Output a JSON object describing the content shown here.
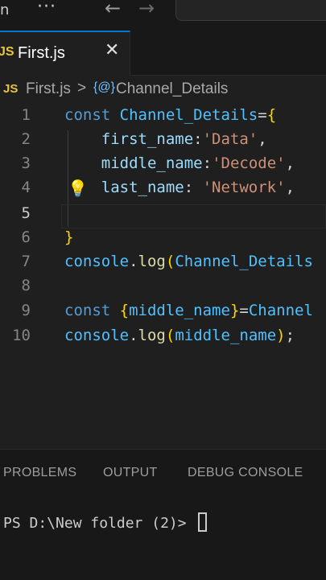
{
  "titlebar": {
    "left_text": "n",
    "more": "···",
    "back": "←",
    "forward": "→"
  },
  "tab": {
    "lang": "JS",
    "name": "First.js",
    "close": "✕"
  },
  "breadcrumb": {
    "lang": "JS",
    "file": "First.js",
    "sep": ">",
    "symbol_icon": "{@}",
    "symbol": "Channel_Details"
  },
  "editor": {
    "line_numbers": [
      "1",
      "2",
      "3",
      "4",
      "5",
      "6",
      "7",
      "8",
      "9",
      "10"
    ],
    "lines": {
      "l1": {
        "kw": "const",
        "name": "Channel_Details",
        "op": "=",
        "brace": "{"
      },
      "l2": {
        "prop": "first_name",
        "colon": ":",
        "str": "'Data'",
        "comma": ","
      },
      "l3": {
        "prop": "middle_name",
        "colon": ":",
        "str": "'Decode'",
        "comma": ","
      },
      "l4": {
        "prop": "last_name",
        "colon": ": ",
        "str": "'Network'",
        "comma": ","
      },
      "l6": {
        "brace": "}"
      },
      "l7": {
        "obj": "console",
        "dot": ".",
        "fn": "log",
        "paren": "(",
        "arg": "Channel_Details"
      },
      "l9": {
        "kw": "const",
        "brace_open": "{",
        "name": "middle_name",
        "brace_close": "}",
        "op": "=",
        "rhs": "Channel"
      },
      "l10": {
        "obj": "console",
        "dot": ".",
        "fn": "log",
        "paren_open": "(",
        "arg": "middle_name",
        "paren_close": ")",
        "semi": ";"
      }
    },
    "lightbulb": "💡"
  },
  "panel": {
    "tabs": [
      "PROBLEMS",
      "OUTPUT",
      "DEBUG CONSOLE"
    ],
    "terminal_prompt": "PS D:\\New folder (2)> "
  }
}
